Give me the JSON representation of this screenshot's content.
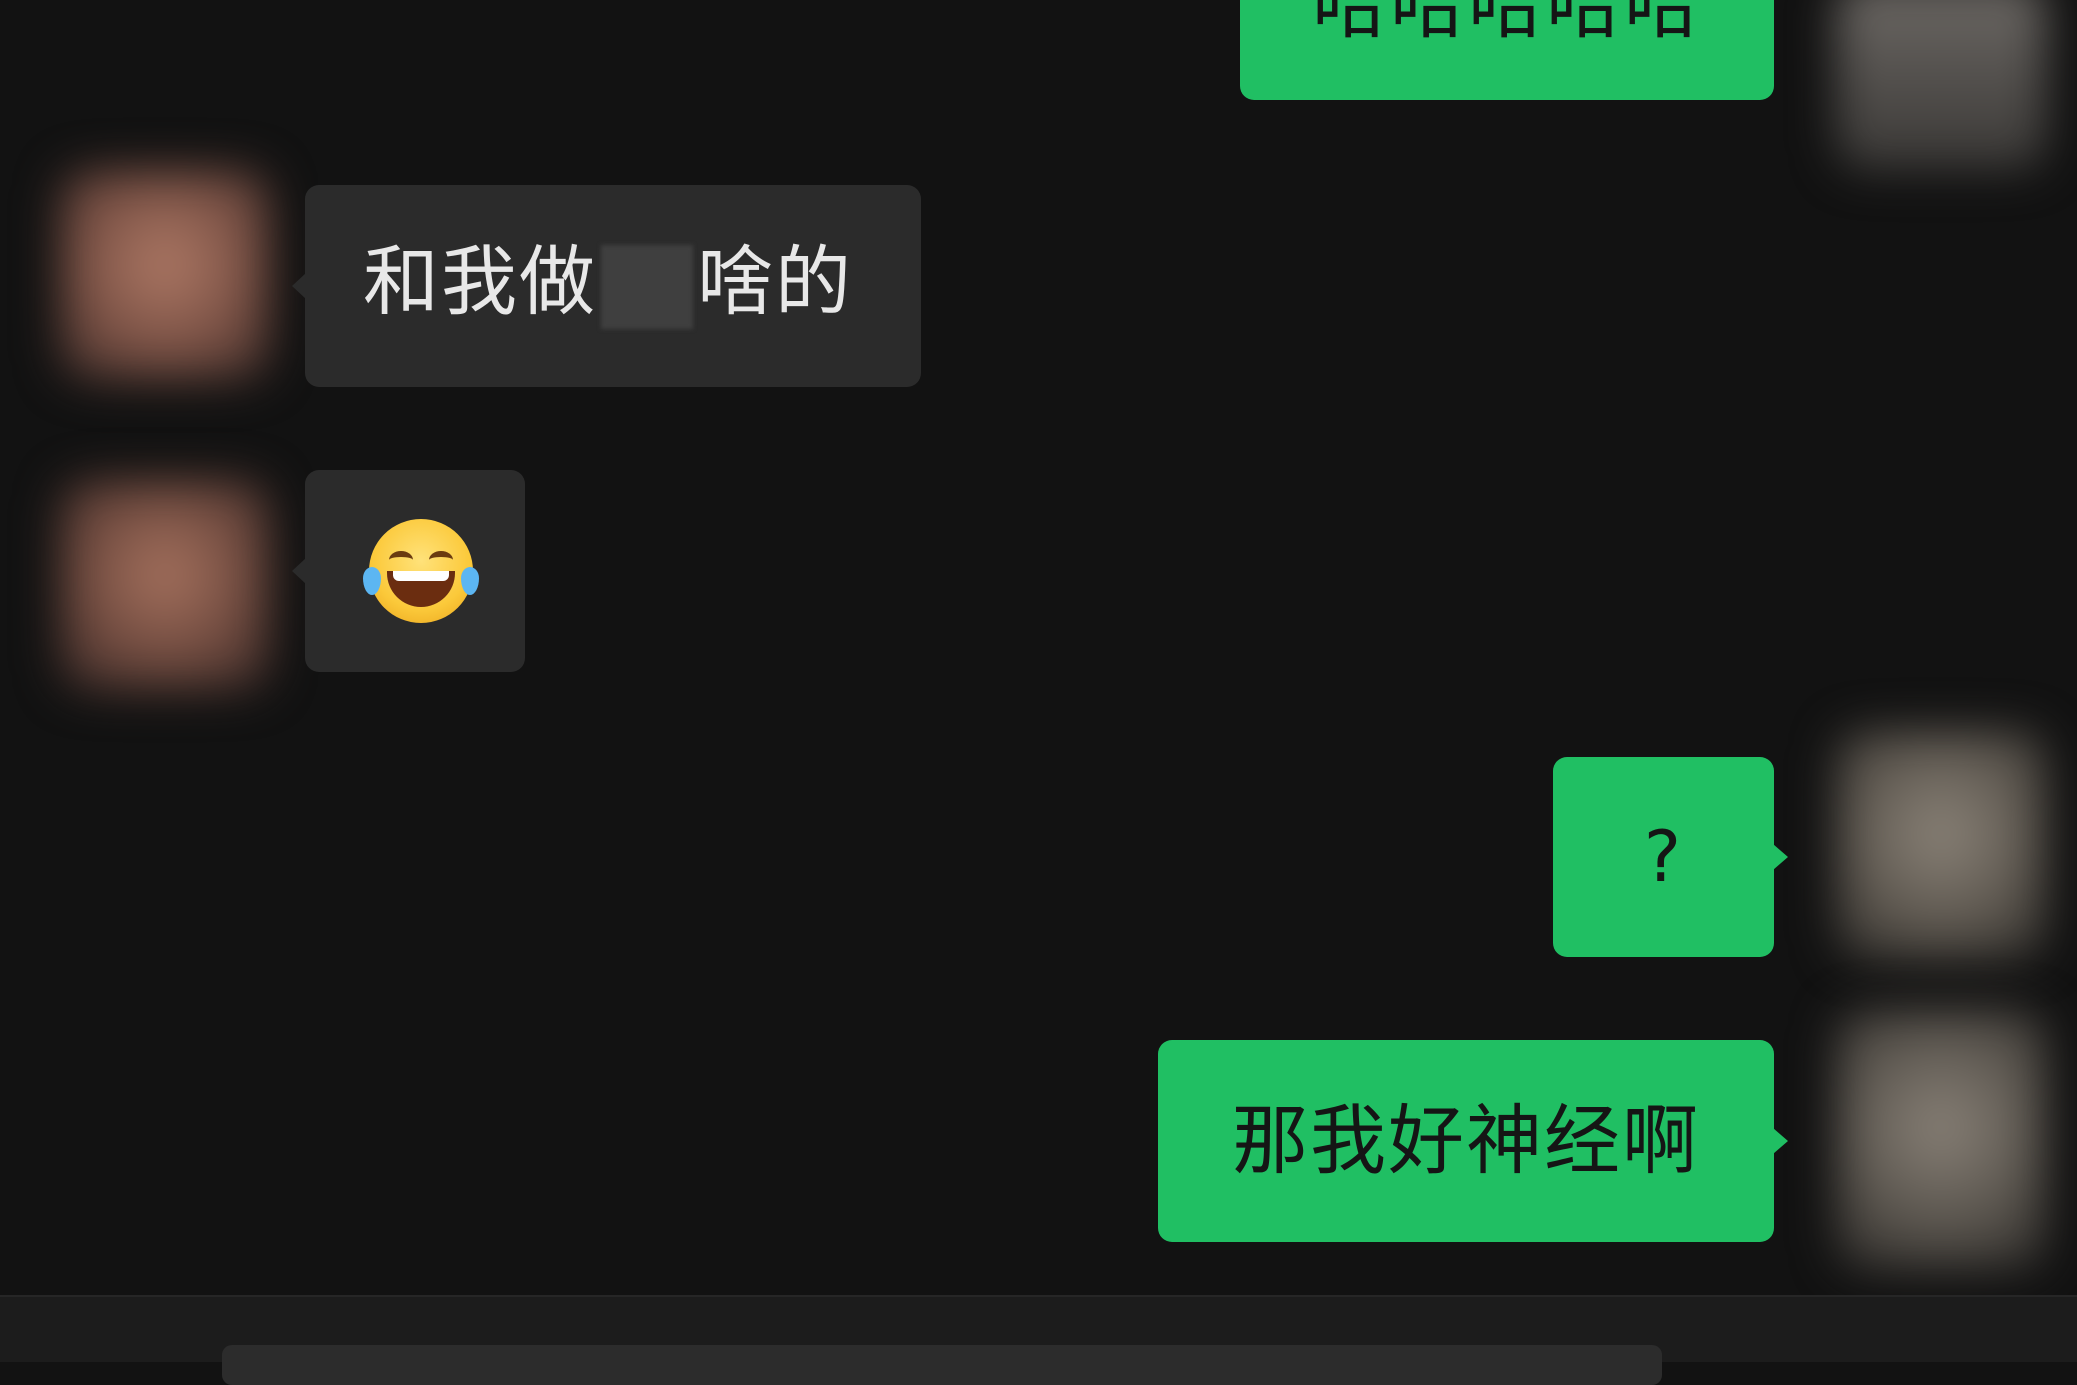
{
  "chat": {
    "messages": [
      {
        "id": "m1",
        "side": "sent",
        "text": "哈哈哈哈哈"
      },
      {
        "id": "m2",
        "side": "received",
        "text_before": "和我做",
        "text_after": "啥的",
        "redacted": true
      },
      {
        "id": "m3",
        "side": "received",
        "emoji": "face-with-tears-of-joy-icon"
      },
      {
        "id": "m4",
        "side": "sent",
        "text": "?"
      },
      {
        "id": "m5",
        "side": "sent",
        "text": "那我好神经啊"
      }
    ]
  },
  "colors": {
    "background": "#121212",
    "sent_bubble": "#20bf63",
    "received_bubble": "#2b2b2b",
    "received_text": "#e8e8e8",
    "sent_text": "#151515"
  }
}
